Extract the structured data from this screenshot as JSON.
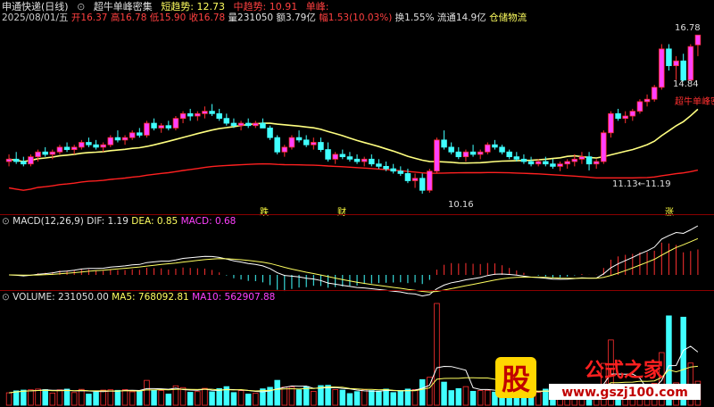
{
  "header": {
    "stock": "申通快递(日线)",
    "indicator": "超牛单峰密集",
    "short_trend_label": "短趋势: 12.73",
    "mid_trend_label": "中趋势: 10.91",
    "single_peak_label": "单峰:"
  },
  "quote": {
    "date": "2025/08/01/五",
    "open": "开16.37",
    "high": "高16.78",
    "low": "低15.90",
    "close": "收16.78",
    "volume": "量231050",
    "amount": "额3.79亿",
    "change": "幅1.53(10.03%)",
    "turnover": "换1.55%",
    "float": "流通14.9亿",
    "industry": "仓储物流"
  },
  "annotations": {
    "high_price": "16.78",
    "recent_low": "14.84",
    "low_price": "10.16",
    "range_label": "11.13←11.19",
    "peak_label": "超牛单峰密集",
    "event_fall": "跌",
    "event_fin": "财",
    "event_rise": "涨"
  },
  "macd_panel": {
    "label": "MACD(12,26,9)",
    "dif": "DIF: 1.19",
    "dea": "DEA: 0.85",
    "macd": "MACD: 0.68"
  },
  "volume_panel": {
    "label": "VOLUME: 231050.00",
    "ma5": "MA5: 768092.81",
    "ma10": "MA10: 562907.88"
  },
  "logo": {
    "char": "股",
    "title": "公式之家",
    "url": "www.gszj100.com"
  },
  "colors": {
    "up": "#ff3030",
    "up_fill": "#ff40ff",
    "down": "#40ffff",
    "ma_yellow": "#ffff80",
    "ma_red": "#ff2020",
    "label_red": "#ff4040",
    "label_yellow": "#ffff00",
    "label_magenta": "#ff40ff"
  },
  "chart_data": {
    "type": "candlestick",
    "ohlc": [
      [
        11.5,
        11.8,
        11.3,
        11.6
      ],
      [
        11.6,
        11.9,
        11.4,
        11.5
      ],
      [
        11.5,
        11.7,
        11.3,
        11.4
      ],
      [
        11.4,
        11.8,
        11.3,
        11.7
      ],
      [
        11.7,
        12.0,
        11.5,
        11.9
      ],
      [
        11.9,
        12.1,
        11.7,
        11.8
      ],
      [
        11.8,
        12.0,
        11.6,
        11.9
      ],
      [
        11.9,
        12.2,
        11.8,
        12.1
      ],
      [
        12.1,
        12.3,
        11.9,
        12.0
      ],
      [
        12.0,
        12.2,
        11.8,
        12.1
      ],
      [
        12.1,
        12.4,
        12.0,
        12.3
      ],
      [
        12.3,
        12.5,
        12.1,
        12.2
      ],
      [
        12.2,
        12.4,
        12.0,
        12.1
      ],
      [
        12.1,
        12.3,
        11.9,
        12.2
      ],
      [
        12.2,
        12.6,
        12.1,
        12.5
      ],
      [
        12.5,
        12.8,
        12.3,
        12.4
      ],
      [
        12.4,
        12.6,
        12.2,
        12.5
      ],
      [
        12.5,
        12.8,
        12.4,
        12.7
      ],
      [
        12.7,
        12.9,
        12.5,
        12.6
      ],
      [
        12.6,
        13.2,
        12.5,
        13.1
      ],
      [
        13.1,
        13.3,
        12.8,
        12.9
      ],
      [
        12.9,
        13.1,
        12.7,
        13.0
      ],
      [
        13.0,
        13.2,
        12.8,
        12.9
      ],
      [
        12.9,
        13.4,
        12.8,
        13.3
      ],
      [
        13.3,
        13.6,
        13.1,
        13.5
      ],
      [
        13.5,
        13.7,
        13.2,
        13.4
      ],
      [
        13.4,
        13.6,
        13.2,
        13.5
      ],
      [
        13.5,
        13.8,
        13.3,
        13.6
      ],
      [
        13.6,
        13.9,
        13.4,
        13.5
      ],
      [
        13.5,
        13.7,
        13.2,
        13.3
      ],
      [
        13.3,
        13.5,
        13.0,
        13.1
      ],
      [
        13.1,
        13.3,
        12.9,
        13.0
      ],
      [
        13.0,
        13.2,
        12.8,
        13.1
      ],
      [
        13.1,
        13.3,
        12.9,
        13.0
      ],
      [
        13.0,
        13.2,
        12.9,
        13.1
      ],
      [
        13.1,
        13.3,
        12.9,
        12.9
      ],
      [
        12.9,
        13.0,
        12.4,
        12.5
      ],
      [
        12.5,
        12.6,
        11.8,
        11.9
      ],
      [
        11.9,
        12.2,
        11.7,
        12.1
      ],
      [
        12.1,
        12.6,
        12.0,
        12.5
      ],
      [
        12.5,
        12.8,
        12.3,
        12.4
      ],
      [
        12.4,
        12.6,
        12.1,
        12.2
      ],
      [
        12.2,
        12.5,
        12.0,
        12.3
      ],
      [
        12.3,
        12.5,
        11.9,
        12.0
      ],
      [
        12.0,
        12.3,
        11.5,
        11.6
      ],
      [
        11.6,
        11.9,
        11.4,
        11.8
      ],
      [
        11.8,
        12.0,
        11.6,
        11.7
      ],
      [
        11.7,
        11.9,
        11.5,
        11.6
      ],
      [
        11.6,
        11.8,
        11.4,
        11.5
      ],
      [
        11.5,
        11.7,
        11.3,
        11.6
      ],
      [
        11.6,
        11.8,
        11.3,
        11.4
      ],
      [
        11.4,
        11.6,
        11.2,
        11.3
      ],
      [
        11.3,
        11.5,
        11.1,
        11.2
      ],
      [
        11.2,
        11.4,
        11.0,
        11.1
      ],
      [
        11.1,
        11.3,
        10.9,
        11.0
      ],
      [
        11.0,
        11.2,
        10.6,
        10.7
      ],
      [
        10.7,
        11.0,
        10.4,
        10.8
      ],
      [
        10.8,
        11.0,
        10.16,
        10.3
      ],
      [
        10.3,
        11.2,
        10.2,
        11.1
      ],
      [
        11.1,
        12.5,
        11.0,
        12.4
      ],
      [
        12.4,
        12.8,
        12.0,
        12.1
      ],
      [
        12.1,
        12.3,
        11.8,
        11.9
      ],
      [
        11.9,
        12.1,
        11.6,
        11.7
      ],
      [
        11.7,
        12.0,
        11.5,
        11.9
      ],
      [
        11.9,
        12.2,
        11.7,
        11.8
      ],
      [
        11.8,
        12.0,
        11.6,
        11.9
      ],
      [
        11.9,
        12.3,
        11.8,
        12.2
      ],
      [
        12.2,
        12.4,
        12.0,
        12.1
      ],
      [
        12.1,
        12.2,
        11.8,
        11.9
      ],
      [
        11.9,
        12.0,
        11.6,
        11.7
      ],
      [
        11.7,
        11.9,
        11.5,
        11.6
      ],
      [
        11.6,
        11.8,
        11.4,
        11.5
      ],
      [
        11.5,
        11.7,
        11.3,
        11.4
      ],
      [
        11.4,
        11.6,
        11.3,
        11.5
      ],
      [
        11.5,
        11.7,
        11.3,
        11.4
      ],
      [
        11.4,
        11.6,
        11.2,
        11.3
      ],
      [
        11.3,
        11.5,
        11.1,
        11.4
      ],
      [
        11.4,
        11.6,
        11.2,
        11.5
      ],
      [
        11.5,
        11.8,
        11.3,
        11.6
      ],
      [
        11.6,
        11.9,
        11.4,
        11.7
      ],
      [
        11.7,
        11.9,
        11.13,
        11.4
      ],
      [
        11.4,
        11.6,
        11.2,
        11.5
      ],
      [
        11.5,
        12.8,
        11.4,
        12.7
      ],
      [
        12.7,
        13.6,
        12.5,
        13.5
      ],
      [
        13.5,
        13.7,
        13.2,
        13.3
      ],
      [
        13.3,
        13.6,
        13.1,
        13.4
      ],
      [
        13.4,
        13.7,
        13.2,
        13.6
      ],
      [
        13.6,
        14.1,
        13.5,
        14.0
      ],
      [
        14.0,
        14.3,
        13.8,
        14.1
      ],
      [
        14.1,
        14.7,
        14.0,
        14.6
      ],
      [
        14.6,
        16.4,
        14.5,
        16.2
      ],
      [
        16.2,
        16.4,
        15.3,
        15.5
      ],
      [
        15.5,
        15.9,
        14.9,
        15.7
      ],
      [
        15.7,
        16.0,
        14.84,
        14.9
      ],
      [
        14.9,
        16.4,
        14.9,
        16.3
      ],
      [
        16.37,
        16.78,
        15.9,
        16.78
      ]
    ],
    "price_range": [
      9.6,
      17.2
    ],
    "macd": {
      "dif_label": "DIF",
      "dea_label": "DEA",
      "macd_label": "MACD",
      "dif_last": 1.19,
      "dea_last": 0.85,
      "macd_last": 0.68
    },
    "volume": {
      "last": 231050.0,
      "ma5": 768092.81,
      "ma10": 562907.88
    }
  }
}
